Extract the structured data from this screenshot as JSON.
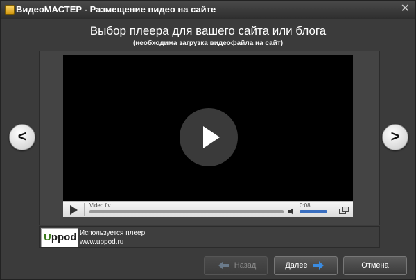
{
  "window": {
    "title": "ВидеоМАСТЕР - Размещение видео на сайте",
    "close_symbol": "✕"
  },
  "header": {
    "title": "Выбор плеера для вашего сайта или блога",
    "subtitle": "(необходима загрузка видеофайла на сайт)"
  },
  "nav": {
    "prev_symbol": "<",
    "next_symbol": ">"
  },
  "player": {
    "filename": "Video.flv",
    "time": "0:08",
    "progress": 0.0,
    "volume": 1.0
  },
  "info": {
    "logo": "Uppod",
    "line1": "Используется плеер",
    "line2": "www.uppod.ru"
  },
  "footer": {
    "back_label": "Назад",
    "next_label": "Далее",
    "cancel_label": "Отмена"
  },
  "colors": {
    "accent_blue": "#3a6fc0",
    "window_bg": "#3b3b3b"
  }
}
